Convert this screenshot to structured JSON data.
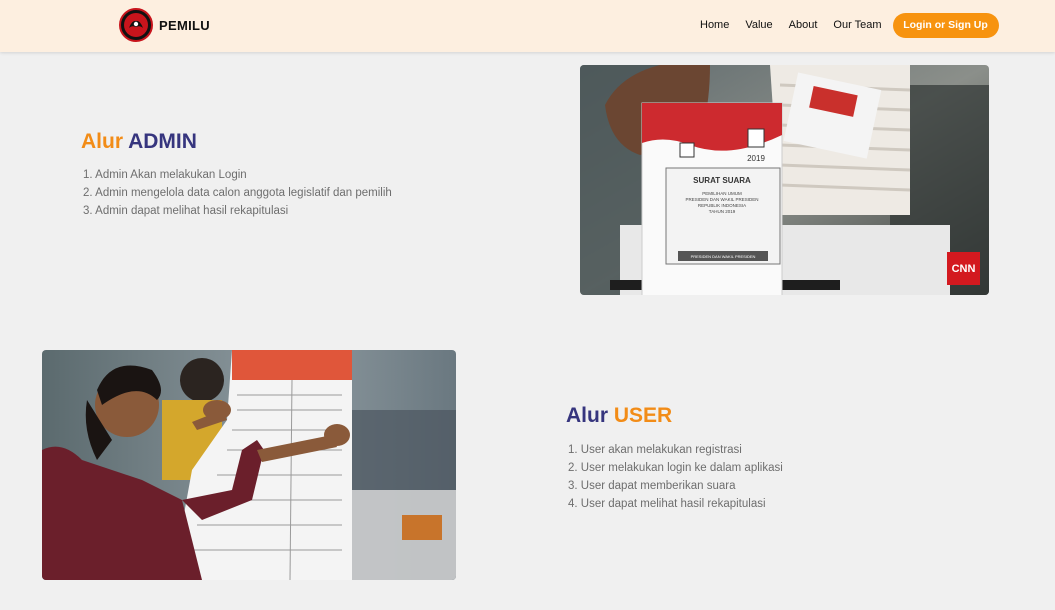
{
  "brand": {
    "name": "PEMILU"
  },
  "nav": {
    "items": [
      "Home",
      "Value",
      "About",
      "Our Team"
    ],
    "login_label": "Login or Sign Up"
  },
  "admin": {
    "title_prefix": "Alur",
    "title_main": "ADMIN",
    "steps": [
      "1. Admin Akan melakukan Login",
      "2. Admin mengelola data calon anggota legislatif dan pemilih",
      "3. Admin dapat melihat hasil rekapitulasi"
    ],
    "photo": {
      "ballot_title": "SURAT SUARA",
      "ballot_sub1": "PEMILIHAN UMUM",
      "ballot_sub2": "PRESIDEN DAN WAKIL PRESIDEN",
      "ballot_sub3": "REPUBLIK INDONESIA",
      "ballot_sub4": "TAHUN 2019",
      "ballot_year": "2019",
      "ballot_footer": "PRESIDEN DAN WAKIL PRESIDEN",
      "watermark": "CNN"
    }
  },
  "user": {
    "title_prefix": "Alur",
    "title_main": "USER",
    "steps": [
      "1. User akan melakukan registrasi",
      "2. User melakukan login ke dalam aplikasi",
      "3. User dapat memberikan suara",
      "4. User dapat melihat hasil rekapitulasi"
    ]
  },
  "colors": {
    "accent": "#f7930f",
    "navy": "#36357e",
    "navbar_bg": "#fdefe0",
    "page_bg": "#f0f0f0"
  }
}
